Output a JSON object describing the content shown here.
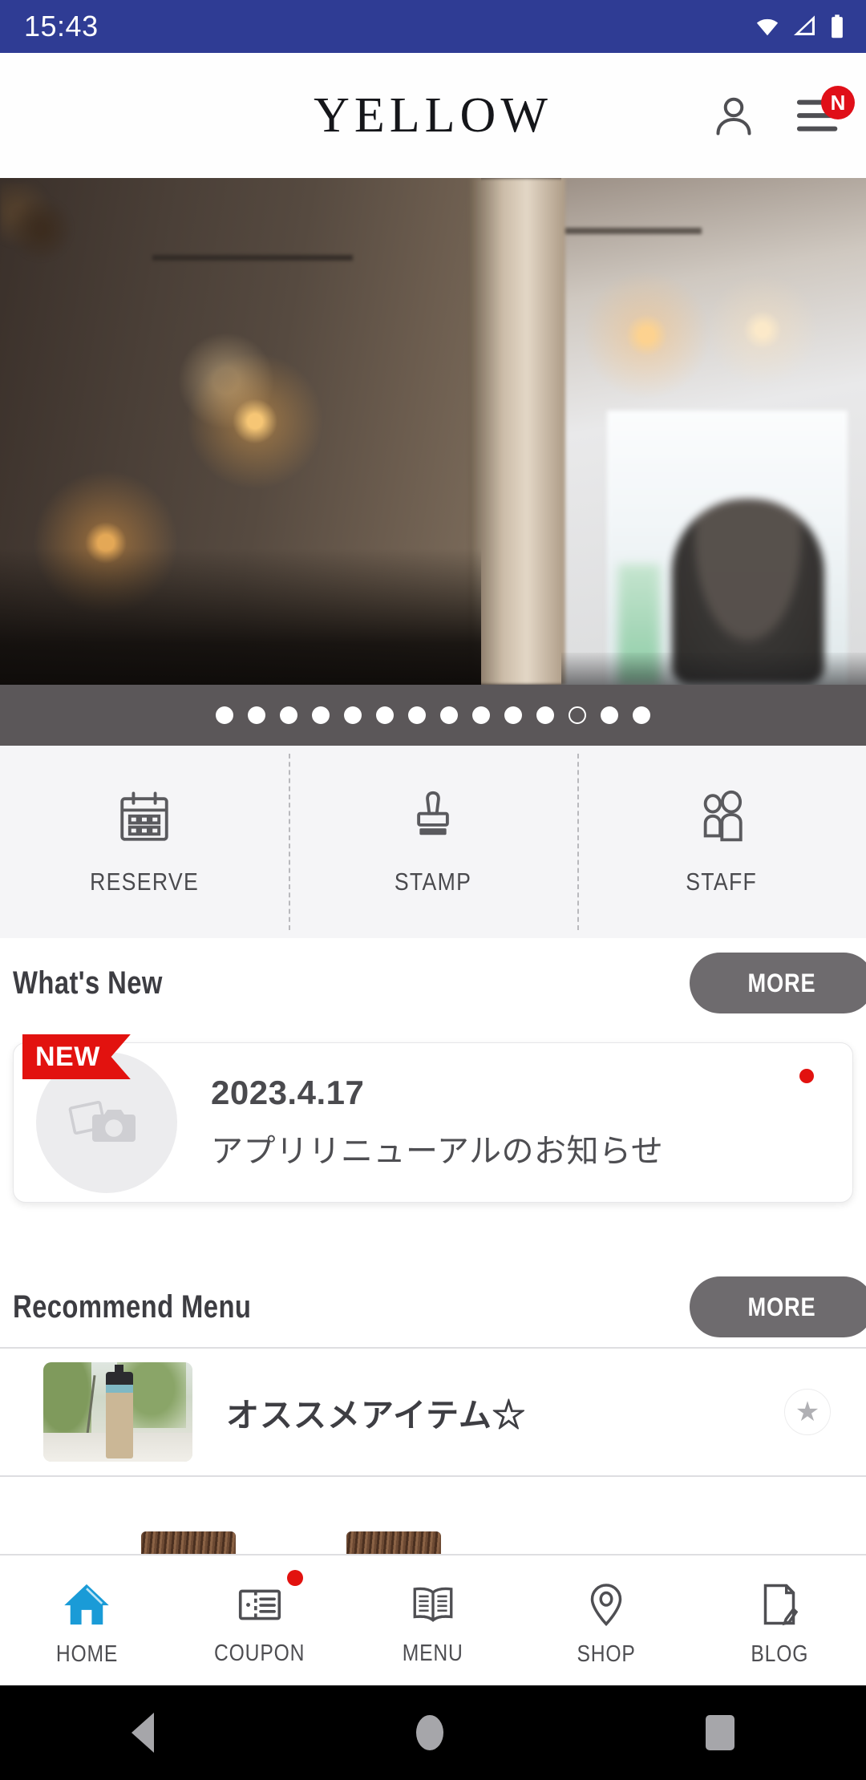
{
  "status_bar": {
    "time": "15:43",
    "icons": [
      "wifi-icon",
      "cellular-signal-icon",
      "battery-icon"
    ],
    "background_color": "#2f3c94"
  },
  "header": {
    "logo": "YELLOW",
    "account_icon": "person-icon",
    "menu_icon": "hamburger-menu-icon",
    "menu_badge": "N",
    "badge_color": "#e00f18"
  },
  "hero": {
    "alt": "salon-interior-photo",
    "carousel": {
      "total_dots": 14,
      "active_index": 11,
      "background_color": "#5b5759"
    }
  },
  "quick_actions": [
    {
      "label": "RESERVE",
      "icon": "calendar-icon"
    },
    {
      "label": "STAMP",
      "icon": "stamp-icon"
    },
    {
      "label": "STAFF",
      "icon": "people-icon"
    }
  ],
  "whats_new": {
    "title": "What's New",
    "more_label": "MORE",
    "items": [
      {
        "badge": "NEW",
        "date": "2023.4.17",
        "title": "アプリリニューアルのお知らせ",
        "thumbnail": "image-placeholder-icon",
        "unread": true
      }
    ]
  },
  "recommend_menu": {
    "title": "Recommend Menu",
    "more_label": "MORE",
    "items": [
      {
        "title": "オススメアイテム☆",
        "thumbnail": "product-bottle-photo",
        "favorite_icon": "star-icon"
      }
    ]
  },
  "bottom_nav": [
    {
      "label": "HOME",
      "icon": "home-icon",
      "active": true,
      "badge": false
    },
    {
      "label": "COUPON",
      "icon": "ticket-icon",
      "active": false,
      "badge": true
    },
    {
      "label": "MENU",
      "icon": "book-icon",
      "active": false,
      "badge": false
    },
    {
      "label": "SHOP",
      "icon": "map-pin-icon",
      "active": false,
      "badge": false
    },
    {
      "label": "BLOG",
      "icon": "document-pen-icon",
      "active": false,
      "badge": false
    }
  ],
  "android_nav": {
    "back": "back-triangle-icon",
    "home": "home-circle-icon",
    "recents": "recents-square-icon"
  },
  "colors": {
    "status_bar": "#2f3c94",
    "accent_blue": "#1a9bd7",
    "badge_red": "#e2120f",
    "more_button": "#6e6b6e"
  }
}
